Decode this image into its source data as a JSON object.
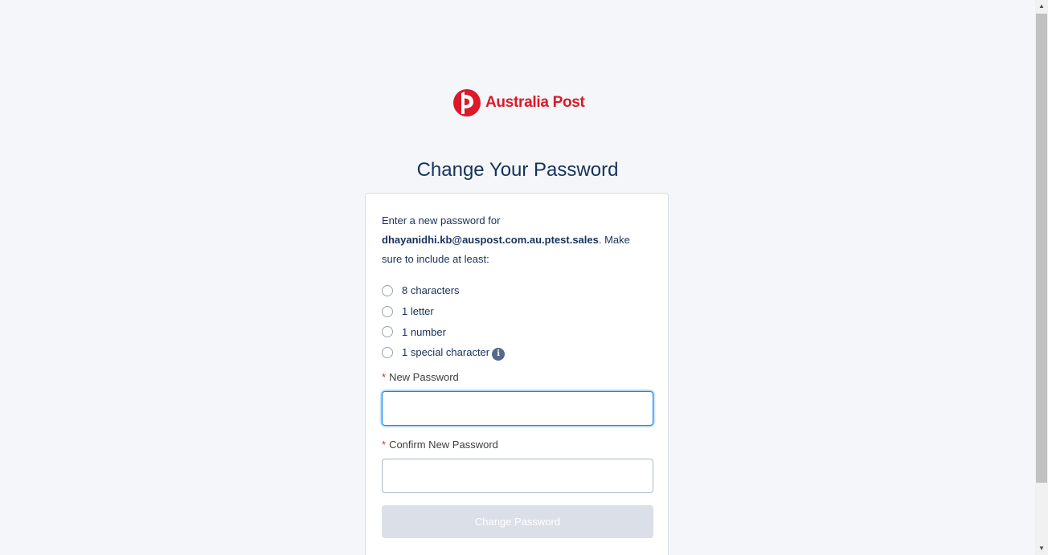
{
  "brand": {
    "name": "Australia Post",
    "color": "#dc1928",
    "logo_icon": "australia-post-logo-icon"
  },
  "page_title": "Change Your Password",
  "intro": {
    "before": "Enter a new password for ",
    "username": "dhayanidhi.kb@auspost.com.au.ptest.sales",
    "after": ". Make sure to include at least:"
  },
  "requirements": [
    "8 characters",
    "1 letter",
    "1 number",
    "1 special character"
  ],
  "fields": {
    "new_password": {
      "required_marker": "*",
      "label": "New Password",
      "value": ""
    },
    "confirm_password": {
      "required_marker": "*",
      "label": "Confirm New Password",
      "value": ""
    }
  },
  "submit_label": "Change Password",
  "info_icon_glyph": "i",
  "colors": {
    "background": "#f4f6f9",
    "text": "#16325c",
    "focus_border": "#1589ee",
    "button_disabled": "#dbdfe7",
    "info_icon": "#54698d"
  }
}
